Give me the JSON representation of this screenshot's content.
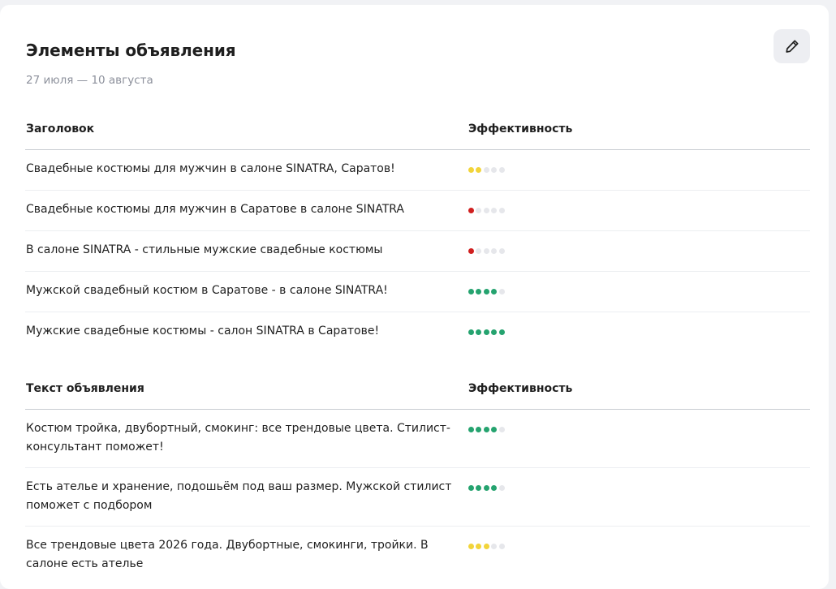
{
  "card": {
    "title": "Элементы объявления",
    "date_range": "27 июля — 10 августа",
    "edit_icon": "pencil-icon"
  },
  "headlines": {
    "col_name": "Заголовок",
    "col_eff": "Эффективность",
    "rows": [
      {
        "text": "Свадебные костюмы для мужчин в салоне SINATRA, Саратов!",
        "rating": 2,
        "level": "yellow"
      },
      {
        "text": "Свадебные костюмы для мужчин в Саратове в салоне SINATRA",
        "rating": 1,
        "level": "red"
      },
      {
        "text": "В салоне SINATRA - стильные мужские свадебные костюмы",
        "rating": 1,
        "level": "red"
      },
      {
        "text": "Мужской свадебный костюм в Саратове - в салоне SINATRA!",
        "rating": 4,
        "level": "green"
      },
      {
        "text": "Мужские свадебные костюмы - салон SINATRA в Саратове!",
        "rating": 5,
        "level": "green"
      }
    ]
  },
  "ad_texts": {
    "col_name": "Текст объявления",
    "col_eff": "Эффективность",
    "rows": [
      {
        "text": "Костюм тройка, двубортный, смокинг: все трендовые цвета. Стилист-консультант поможет!",
        "rating": 4,
        "level": "green"
      },
      {
        "text": "Есть ателье и хранение, подошьём под ваш размер. Мужской стилист поможет с подбором",
        "rating": 4,
        "level": "green"
      },
      {
        "text": "Все трендовые цвета 2026 года. Двубортные, смокинги, тройки. В салоне есть ателье",
        "rating": 3,
        "level": "yellow"
      }
    ]
  },
  "colors": {
    "green": "#25a36f",
    "yellow": "#f2d43a",
    "red": "#d01f1f",
    "empty": "#e6e7eb"
  }
}
